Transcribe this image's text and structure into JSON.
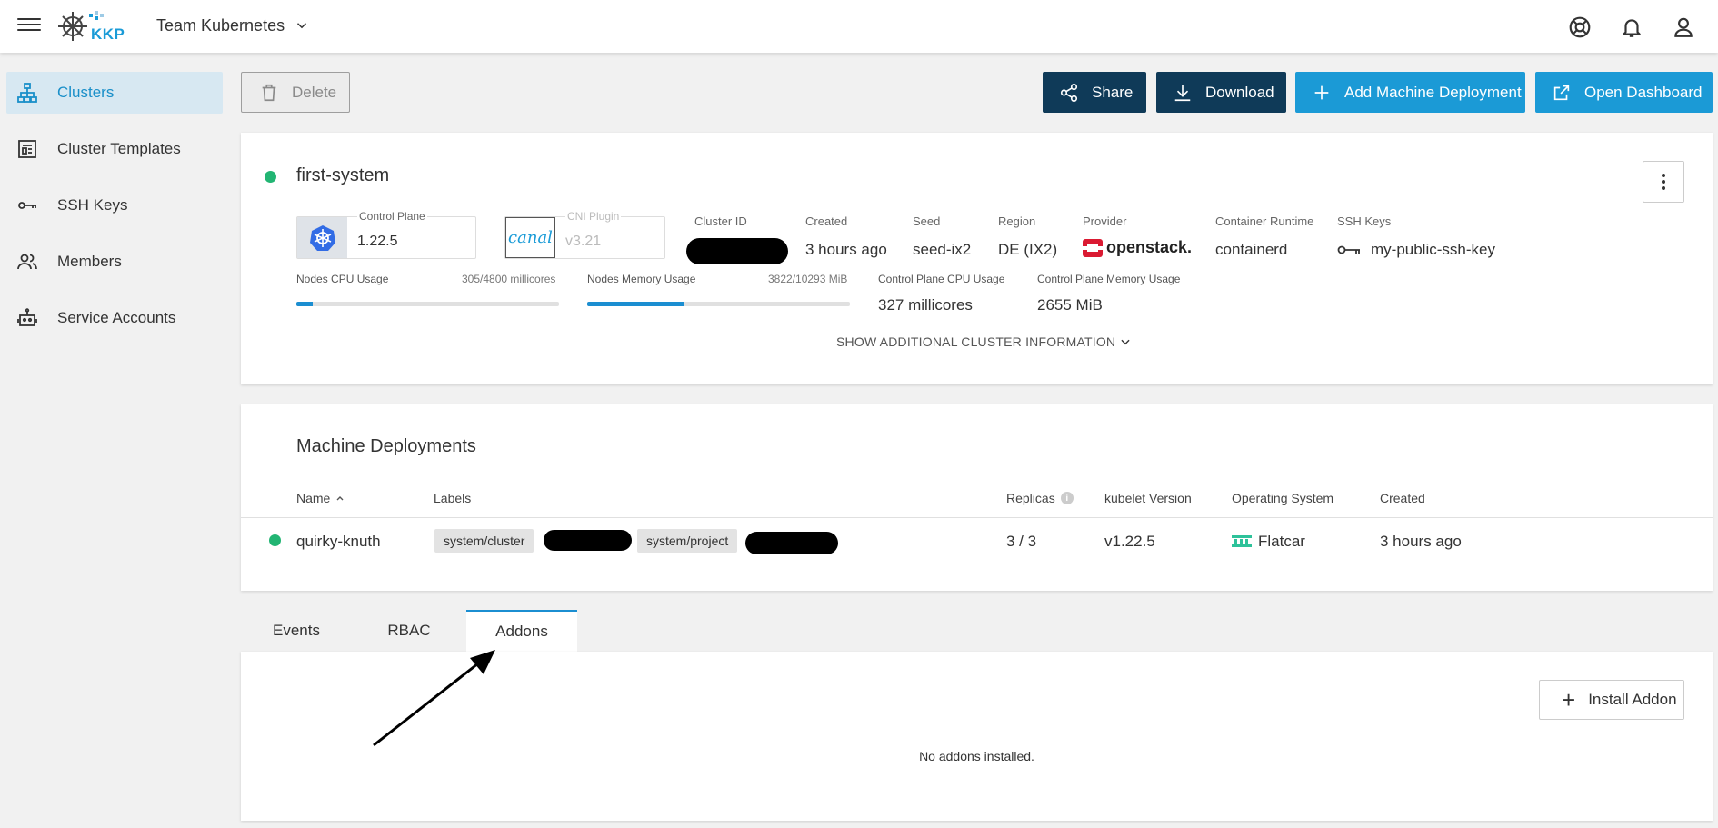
{
  "header": {
    "logo_text": "KKP",
    "project_name": "Team Kubernetes"
  },
  "sidebar": {
    "items": [
      {
        "label": "Clusters",
        "icon": "cluster-icon",
        "active": true
      },
      {
        "label": "Cluster Templates",
        "icon": "template-icon",
        "active": false
      },
      {
        "label": "SSH Keys",
        "icon": "key-icon",
        "active": false
      },
      {
        "label": "Members",
        "icon": "members-icon",
        "active": false
      },
      {
        "label": "Service Accounts",
        "icon": "robot-icon",
        "active": false
      }
    ]
  },
  "actions": {
    "delete": "Delete",
    "share": "Share",
    "download": "Download",
    "add_md": "Add Machine Deployment",
    "open_dashboard": "Open Dashboard"
  },
  "cluster": {
    "name": "first-system",
    "status_color": "#22b573",
    "control_plane_label": "Control Plane",
    "control_plane_version": "1.22.5",
    "cni_logo_text": "canal",
    "cni_label": "CNI Plugin",
    "cni_version": "v3.21",
    "info": [
      {
        "label": "Cluster ID",
        "value": ""
      },
      {
        "label": "Created",
        "value": "3 hours ago"
      },
      {
        "label": "Seed",
        "value": "seed-ix2"
      },
      {
        "label": "Region",
        "value": "DE (IX2)"
      },
      {
        "label": "Provider",
        "value": "openstack."
      },
      {
        "label": "Container Runtime",
        "value": "containerd"
      },
      {
        "label": "SSH Keys",
        "value": "my-public-ssh-key"
      }
    ],
    "cpu_usage_label": "Nodes CPU Usage",
    "cpu_usage_value": "305/4800 millicores",
    "cpu_usage_fraction": 0.064,
    "mem_usage_label": "Nodes Memory Usage",
    "mem_usage_value": "3822/10293 MiB",
    "mem_usage_fraction": 0.371,
    "cp_cpu_label": "Control Plane CPU Usage",
    "cp_cpu_value": "327 millicores",
    "cp_mem_label": "Control Plane Memory Usage",
    "cp_mem_value": "2655 MiB",
    "show_more": "SHOW ADDITIONAL CLUSTER INFORMATION"
  },
  "machine_deployments": {
    "title": "Machine Deployments",
    "columns": [
      "Name",
      "Labels",
      "Replicas",
      "kubelet Version",
      "Operating System",
      "Created"
    ],
    "rows": [
      {
        "name": "quirky-knuth",
        "labels": [
          "system/cluster",
          "system/project"
        ],
        "replicas": "3 / 3",
        "kubelet": "v1.22.5",
        "os": "Flatcar",
        "created": "3 hours ago"
      }
    ]
  },
  "tabs": [
    {
      "label": "Events",
      "active": false
    },
    {
      "label": "RBAC",
      "active": false
    },
    {
      "label": "Addons",
      "active": true
    }
  ],
  "addons": {
    "install_label": "Install Addon",
    "empty_message": "No addons installed."
  }
}
